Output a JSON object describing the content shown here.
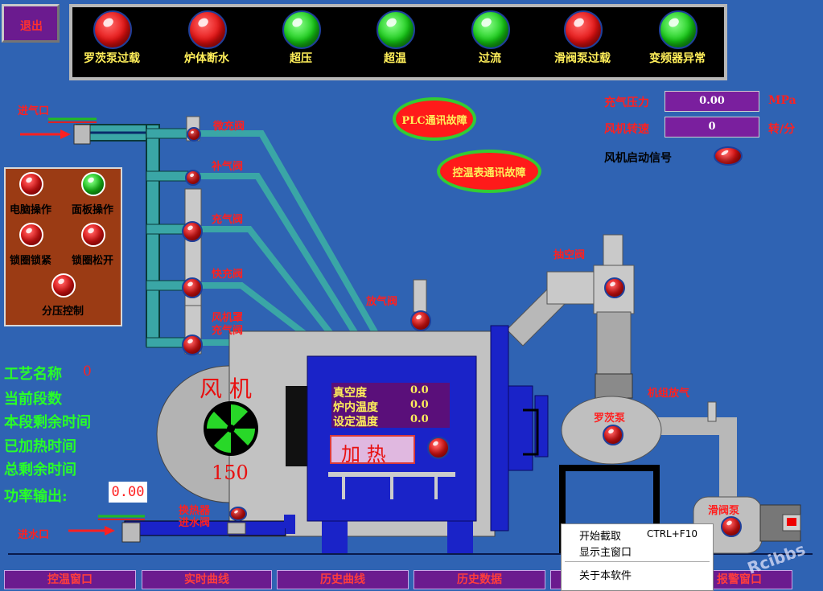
{
  "exit_button": "退出",
  "alarm_lamps": [
    {
      "label": "罗茨泵过载",
      "state": "red"
    },
    {
      "label": "炉体断水",
      "state": "red"
    },
    {
      "label": "超压",
      "state": "green"
    },
    {
      "label": "超温",
      "state": "green"
    },
    {
      "label": "过流",
      "state": "green"
    },
    {
      "label": "滑阀泵过载",
      "state": "red"
    },
    {
      "label": "变频器异常",
      "state": "green"
    }
  ],
  "plc_fault": "PLC通讯故障",
  "temp_ctrl_fault": "控温表通讯故障",
  "readouts": {
    "charge_pressure_label": "充气压力",
    "charge_pressure_value": "0.00",
    "charge_pressure_unit": "MPa",
    "fan_speed_label": "风机转速",
    "fan_speed_value": "0",
    "fan_speed_unit": "转/分",
    "fan_start_label": "风机启动信号"
  },
  "control_panel": {
    "items": [
      {
        "label": "电脑操作",
        "state": "red"
      },
      {
        "label": "面板操作",
        "state": "green"
      },
      {
        "label": "锁圈锁紧",
        "state": "red"
      },
      {
        "label": "锁圈松开",
        "state": "red"
      },
      {
        "label": "分压控制",
        "state": "red"
      }
    ]
  },
  "labels": {
    "inlet_gas": "进气口",
    "micro_charge": "微充阀",
    "make_up": "补气阀",
    "charge": "充气阀",
    "fast_charge": "快充阀",
    "fan_cover_charge_1": "风机罩",
    "fan_cover_charge_2": "充气阀",
    "vent": "放气阀",
    "vacuum_valve": "抽空阀",
    "unit_vent": "机组放气",
    "roots_pump": "罗茨泵",
    "slide_pump": "滑阀泵",
    "heat_exchanger_1": "换热器",
    "heat_exchanger_2": "进水阀",
    "water_inlet": "进水口",
    "fan": "风 机",
    "fan_speed": "150",
    "heat_button": "加 热"
  },
  "furnace_display": [
    {
      "label": "真空度",
      "value": "0.0"
    },
    {
      "label": "炉内温度",
      "value": "0.0"
    },
    {
      "label": "设定温度",
      "value": "0.0"
    }
  ],
  "process": {
    "name_label": "工艺名称",
    "name_value": "0",
    "segment_label": "当前段数",
    "remaining_label": "本段剩余时间",
    "heated_label": "已加热时间",
    "total_remaining_label": "总剩余时间",
    "power_label": "功率输出:",
    "power_value": "0.00"
  },
  "tabs": [
    "控温窗口",
    "实时曲线",
    "历史曲线",
    "历史数据",
    "",
    "报警窗口"
  ],
  "context_menu": {
    "start_capture": "开始截取",
    "shortcut": "CTRL+F10",
    "show_main": "显示主窗口",
    "about": "关于本软件"
  },
  "watermark": "Rcibbs",
  "colors": {
    "background": "#2f63b3",
    "tab_bg": "#6b1b8f",
    "value_bg": "#7a1f9e"
  }
}
